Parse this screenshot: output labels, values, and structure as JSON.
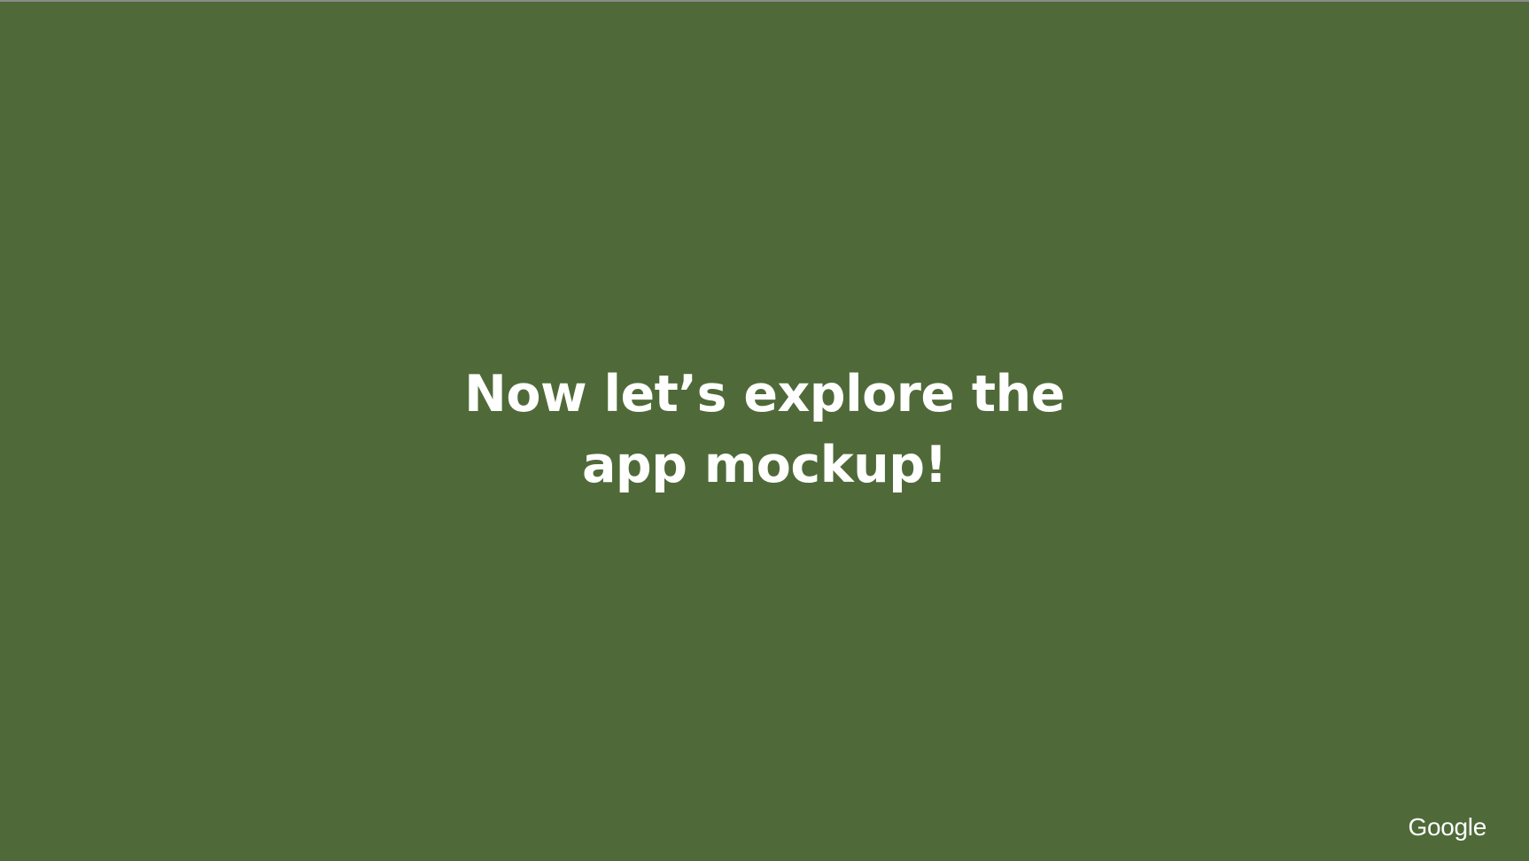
{
  "slide": {
    "background_color": "#4f6a38",
    "title_lines": [
      "Now let’s explore the",
      "app mockup!"
    ],
    "logo_text": "Google"
  }
}
